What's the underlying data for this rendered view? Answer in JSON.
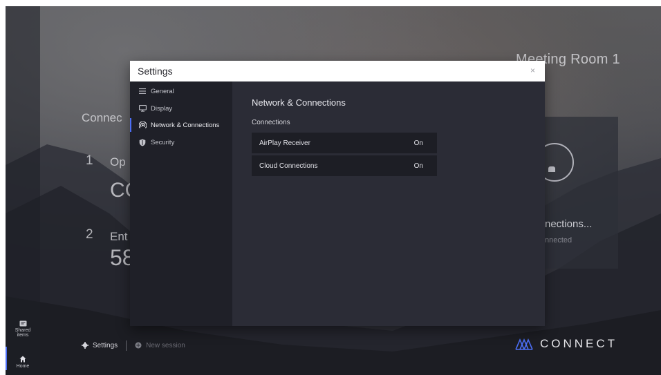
{
  "background": {
    "room_title": "Meeting Room 1",
    "connect_heading": "Connec",
    "steps": [
      {
        "number": "1",
        "text": "Op",
        "code": "CC"
      },
      {
        "number": "2",
        "text": "Ent",
        "code": "58"
      }
    ],
    "connections_card": {
      "title": "nections...",
      "subtitle": "nnected"
    }
  },
  "rail": {
    "items": [
      {
        "label_line1": "Shared",
        "label_line2": "items",
        "icon": "shared-items-icon"
      },
      {
        "label_line1": "Home",
        "label_line2": "",
        "icon": "home-icon"
      }
    ]
  },
  "bottom_bar": {
    "settings_label": "Settings",
    "new_session_label": "New session"
  },
  "brand": {
    "wordmark": "CONNECT",
    "accent_color": "#4c6ef5"
  },
  "dialog": {
    "title": "Settings",
    "close_glyph": "×",
    "nav": [
      {
        "label": "General",
        "icon": "list-icon",
        "active": false
      },
      {
        "label": "Display",
        "icon": "monitor-icon",
        "active": false
      },
      {
        "label": "Network & Connections",
        "icon": "broadcast-icon",
        "active": true
      },
      {
        "label": "Security",
        "icon": "shield-icon",
        "active": false
      }
    ],
    "content": {
      "title": "Network & Connections",
      "section_label": "Connections",
      "rows": [
        {
          "label": "AirPlay Receiver",
          "value": "On"
        },
        {
          "label": "Cloud Connections",
          "value": "On"
        }
      ]
    }
  }
}
